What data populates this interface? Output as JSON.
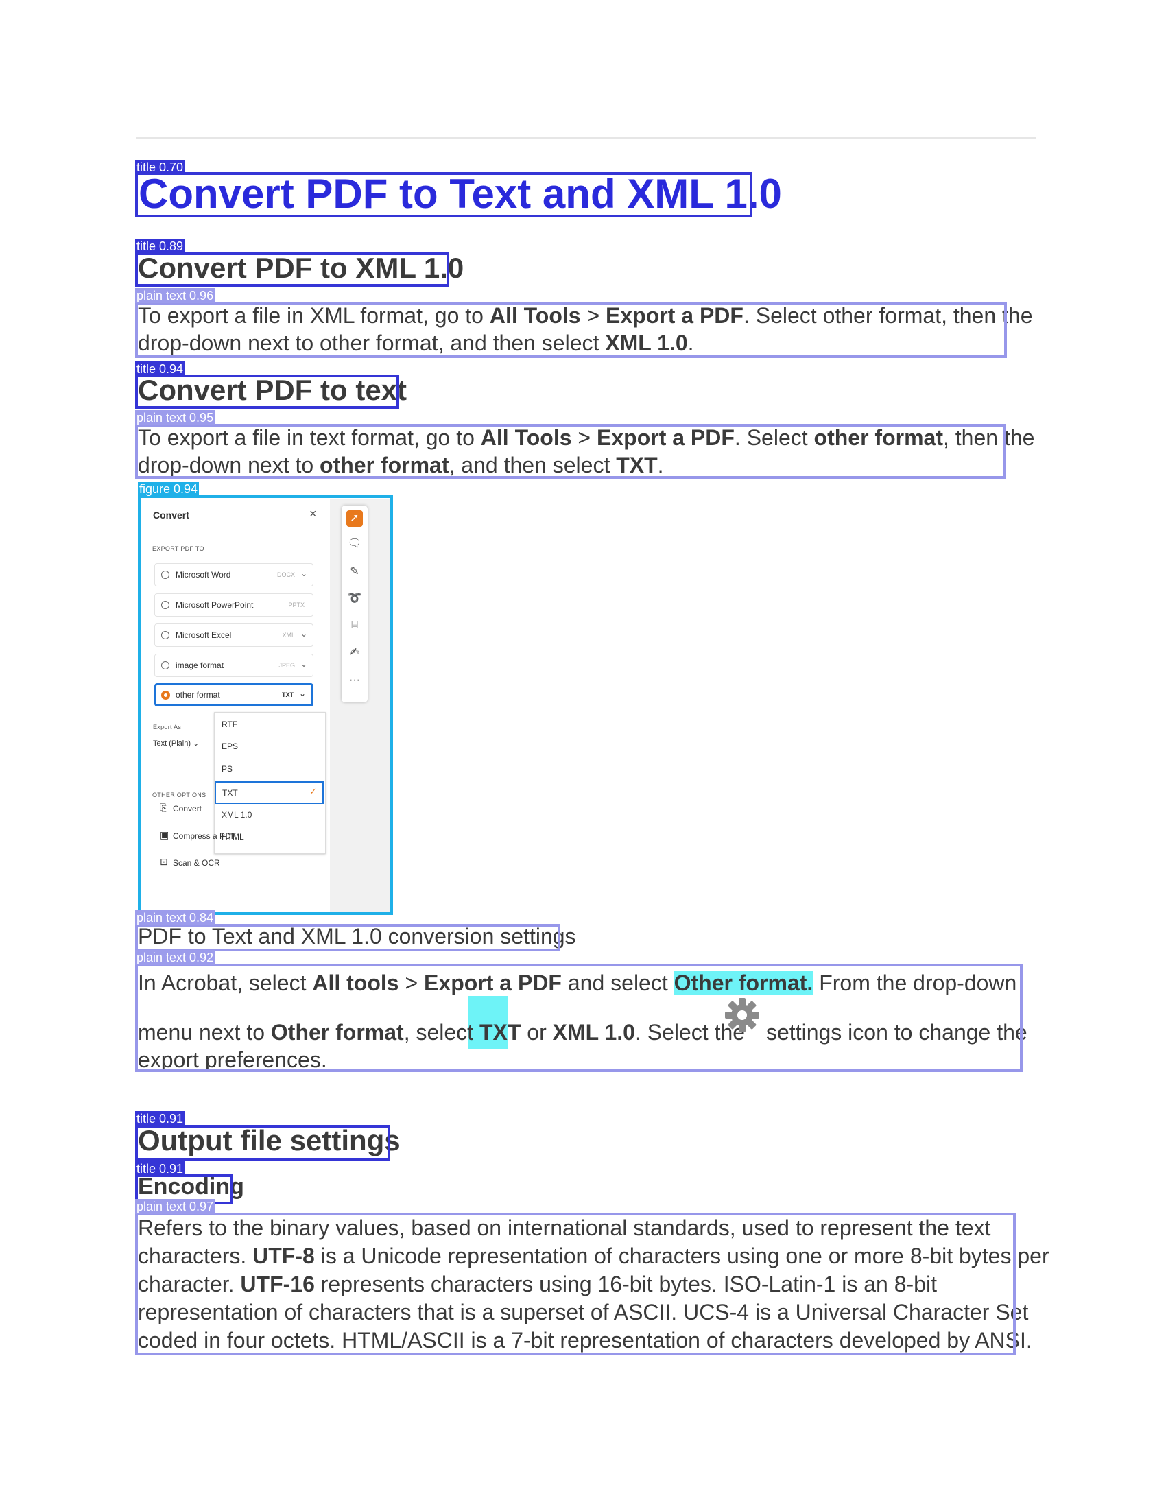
{
  "overlay_tags": {
    "t1": "title 0.70",
    "t2": "title 0.89",
    "p1": "plain text 0.96",
    "t3": "title 0.94",
    "p2": "plain text 0.95",
    "f1": "figure 0.94",
    "p3": "plain text 0.84",
    "p4": "plain text 0.92",
    "t4": "title 0.91",
    "t5": "title 0.91",
    "p5": "plain text 0.97"
  },
  "heading_main": "Convert PDF to Text and XML 1.0",
  "section_xml": {
    "title": "Convert PDF to XML 1.0",
    "l1a": "To export a file in XML format, go to ",
    "l1b": "All Tools",
    "l1c": " > ",
    "l1d": "Export a PDF",
    "l1e": ".  Select other format, then the",
    "l2a": "drop-down next to other format, and then select ",
    "l2b": "XML 1.0",
    "l2c": "."
  },
  "section_text": {
    "title": "Convert PDF to text",
    "l1a": "To export a file in text format, go to ",
    "l1b": "All Tools",
    "l1c": " > ",
    "l1d": "Export a PDF",
    "l1e": ".  Select ",
    "l1f": "other format",
    "l1g": ", then the",
    "l2a": "drop-down next to ",
    "l2b": "other format",
    "l2c": ", and then select ",
    "l2d": "TXT",
    "l2e": "."
  },
  "figure": {
    "panel_title": "Convert",
    "close": "×",
    "export_label": "EXPORT PDF TO",
    "options": [
      {
        "label": "Microsoft Word",
        "format": "DOCX"
      },
      {
        "label": "Microsoft PowerPoint",
        "format": "PPTX"
      },
      {
        "label": "Microsoft Excel",
        "format": "XML"
      },
      {
        "label": "image format",
        "format": "JPEG"
      },
      {
        "label": "other format",
        "format": "TXT"
      }
    ],
    "export_as_label": "Export As",
    "export_as_value": "Text (Plain)",
    "dropdown_items": [
      "RTF",
      "EPS",
      "PS",
      "TXT",
      "XML 1.0",
      "HTML"
    ],
    "dropdown_check": "✓",
    "other_options_label": "OTHER OPTIONS",
    "links": [
      "Convert",
      "Compress a PDF",
      "Scan & OCR"
    ],
    "tool_more": "···"
  },
  "caption": "PDF to Text and XML 1.0 conversion settings",
  "settings_para": {
    "l1a": "In Acrobat, select ",
    "l1b": "All tools",
    "l1c": " > ",
    "l1d": "Export a PDF",
    "l1e": " and select ",
    "l1f": "Other format.",
    "l1g": " From the drop-down",
    "l2a": "menu next to ",
    "l2b": "Other format",
    "l2c": ", select ",
    "l2d": "TXT",
    "l2e": " or ",
    "l2f": "XML 1.0",
    "l2g": ". Select the",
    "l2h": "settings icon to change the",
    "l3": "export preferences."
  },
  "output_title": "Output file settings",
  "encoding": {
    "title": "Encoding",
    "l1": "Refers to the binary values, based on international standards, used to represent the text",
    "l2a": "characters. ",
    "l2b": "UTF-8",
    "l2c": " is a Unicode representation of characters using one or more 8-bit bytes per",
    "l3a": "character. ",
    "l3b": "UTF-16",
    "l3c": " represents characters using 16-bit bytes. ISO-Latin-1 is an 8-bit",
    "l4": "representation of characters that is a superset of ASCII. UCS-4 is a Universal Character Set",
    "l5": "coded in four octets. HTML/ASCII is a 7-bit representation of characters developed by ANSI."
  },
  "colors": {
    "title_box": "#3535d6",
    "plain_box": "#9797ea",
    "figure_box": "#1fb0e8",
    "main_heading": "#2a2adb",
    "highlight": "#6ef3f7",
    "acrobat_orange": "#e8791d",
    "selection_blue": "#1d74d9"
  }
}
